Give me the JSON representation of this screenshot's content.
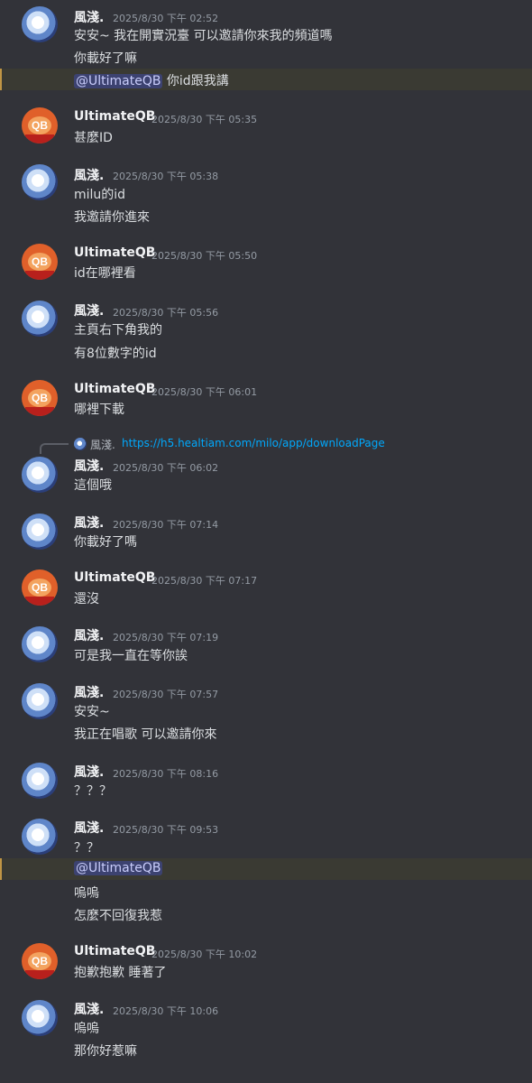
{
  "messages": [
    {
      "author": "風淺.",
      "time": "2025/8/30 下午 02:52",
      "lines": [
        "安安~ 我在開實況臺 可以邀請你來我的頻道嗎",
        "你載好了嘛"
      ]
    },
    {
      "mention": "@UltimateQB",
      "mention_text": "你id跟我講"
    },
    {
      "author": "UltimateQB",
      "time": "2025/8/30 下午 05:35",
      "lines": [
        "甚麼ID"
      ]
    },
    {
      "author": "風淺.",
      "time": "2025/8/30 下午 05:38",
      "lines": [
        "milu的id",
        "我邀請你進來"
      ]
    },
    {
      "author": "UltimateQB",
      "time": "2025/8/30 下午 05:50",
      "lines": [
        "id在哪裡看"
      ]
    },
    {
      "author": "風淺.",
      "time": "2025/8/30 下午 05:56",
      "lines": [
        "主頁右下角我的",
        "有8位數字的id"
      ]
    },
    {
      "author": "UltimateQB",
      "time": "2025/8/30 下午 06:01",
      "lines": [
        "哪裡下載"
      ]
    },
    {
      "author": "風淺.",
      "time": "2025/8/30 下午 06:02",
      "lines": [
        "這個哦"
      ]
    },
    {
      "author": "風淺.",
      "time": "2025/8/30 下午 07:14",
      "lines": [
        "你載好了嗎"
      ]
    },
    {
      "author": "UltimateQB",
      "time": "2025/8/30 下午 07:17",
      "lines": [
        "還沒"
      ]
    },
    {
      "author": "風淺.",
      "time": "2025/8/30 下午 07:19",
      "lines": [
        "可是我一直在等你誒"
      ]
    },
    {
      "author": "風淺.",
      "time": "2025/8/30 下午 07:57",
      "lines": [
        "安安~",
        "我正在唱歌 可以邀請你來"
      ]
    },
    {
      "author": "風淺.",
      "time": "2025/8/30 下午 08:16",
      "lines": [
        "？？？"
      ]
    },
    {
      "author": "風淺.",
      "time": "2025/8/30 下午 09:53",
      "lines": [
        "？？"
      ]
    },
    {
      "mention": "@UltimateQB",
      "lines_after": [
        "嗚嗚",
        "怎麼不回復我惹"
      ]
    },
    {
      "author": "UltimateQB",
      "time": "2025/8/30 下午 10:02",
      "lines": [
        "抱歉抱歉 睡著了"
      ]
    },
    {
      "author": "風淺.",
      "time": "2025/8/30 下午 10:06",
      "lines": [
        "嗚嗚",
        "那你好惹嘛"
      ]
    }
  ],
  "reply": {
    "author": "風淺.",
    "link": "https://h5.healtiam.com/milo/app/downloadPage"
  }
}
